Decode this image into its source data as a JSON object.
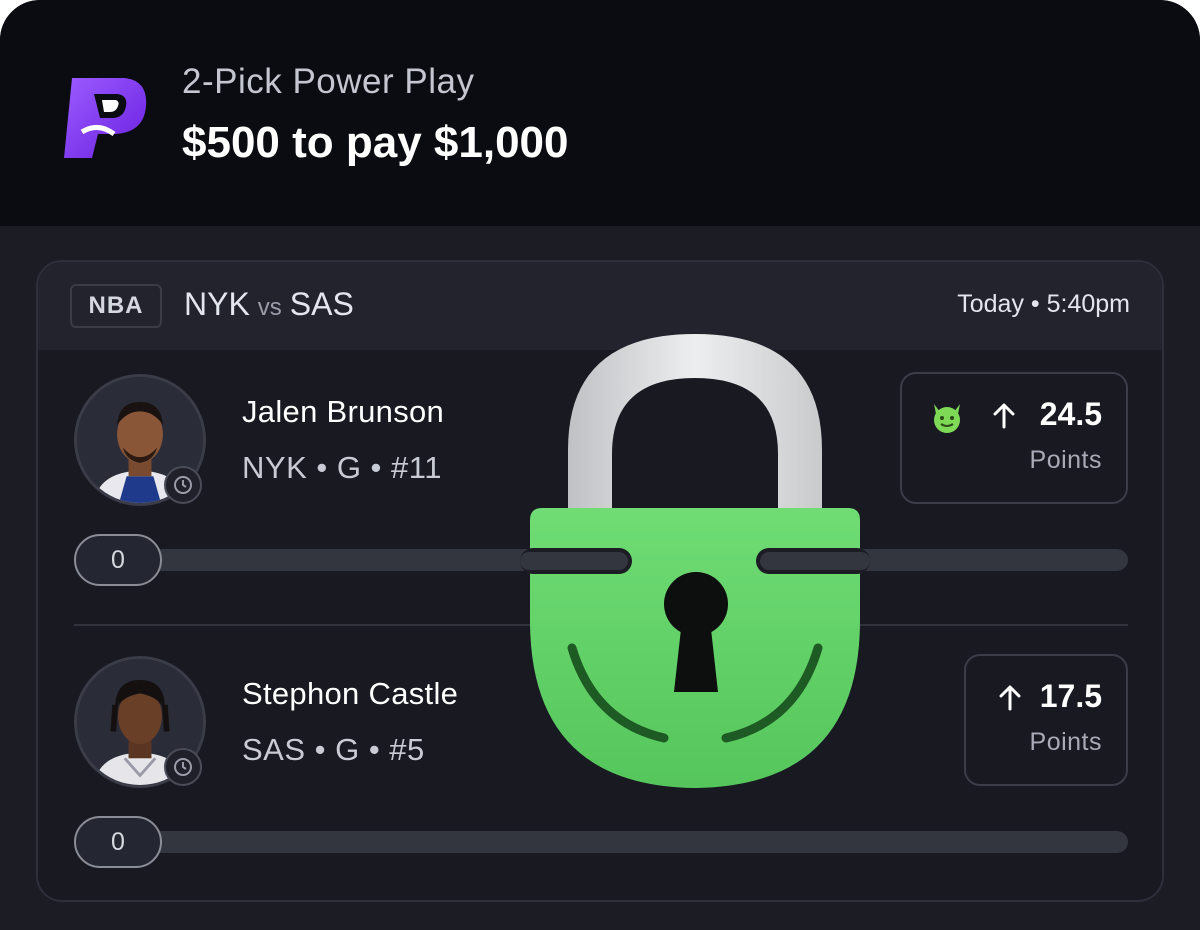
{
  "header": {
    "logo": "prizepicks-logo",
    "play_type": "2-Pick Power Play",
    "stake": "$500 to pay $1,000"
  },
  "game": {
    "league": "NBA",
    "home": "NYK",
    "vs": "vs",
    "away": "SAS",
    "time": "Today • 5:40pm"
  },
  "picks": [
    {
      "name": "Jalen Brunson",
      "info": "NYK • G • #11",
      "direction": "more",
      "line": "24.5",
      "stat": "Points",
      "progress_value": "0",
      "progress_fraction": 0,
      "demon_icon": true
    },
    {
      "name": "Stephon Castle",
      "info": "SAS • G • #5",
      "direction": "more",
      "line": "17.5",
      "stat": "Points",
      "progress_value": "0",
      "progress_fraction": 0,
      "demon_icon": false
    }
  ],
  "overlay": {
    "icon": "green-padlock-icon"
  },
  "colors": {
    "brand_purple": "#7b2ff7",
    "lock_green": "#63d66b",
    "demon_green": "#7ed957",
    "background": "#181921"
  }
}
